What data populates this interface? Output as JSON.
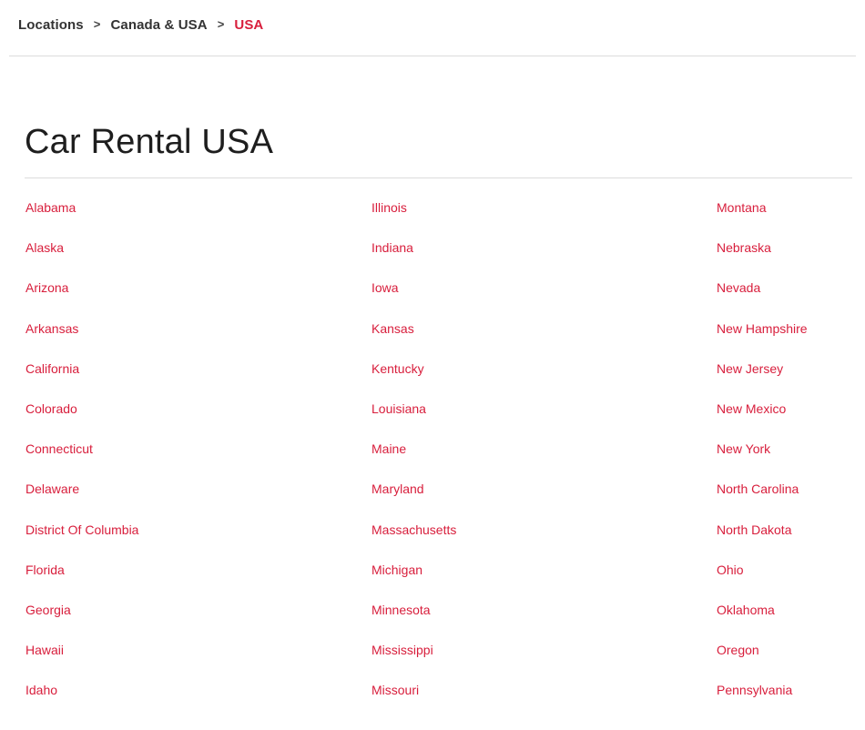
{
  "breadcrumb": {
    "items": [
      "Locations",
      "Canada & USA"
    ],
    "separator": ">",
    "current": "USA"
  },
  "page": {
    "title": "Car Rental USA"
  },
  "colors": {
    "accent": "#d81e3c",
    "text": "#222222",
    "rule": "#dcdcdc"
  },
  "states": {
    "columns": [
      [
        "Alabama",
        "Alaska",
        "Arizona",
        "Arkansas",
        "California",
        "Colorado",
        "Connecticut",
        "Delaware",
        "District Of Columbia",
        "Florida",
        "Georgia",
        "Hawaii",
        "Idaho"
      ],
      [
        "Illinois",
        "Indiana",
        "Iowa",
        "Kansas",
        "Kentucky",
        "Louisiana",
        "Maine",
        "Maryland",
        "Massachusetts",
        "Michigan",
        "Minnesota",
        "Mississippi",
        "Missouri"
      ],
      [
        "Montana",
        "Nebraska",
        "Nevada",
        "New Hampshire",
        "New Jersey",
        "New Mexico",
        "New York",
        "North Carolina",
        "North Dakota",
        "Ohio",
        "Oklahoma",
        "Oregon",
        "Pennsylvania"
      ]
    ]
  }
}
